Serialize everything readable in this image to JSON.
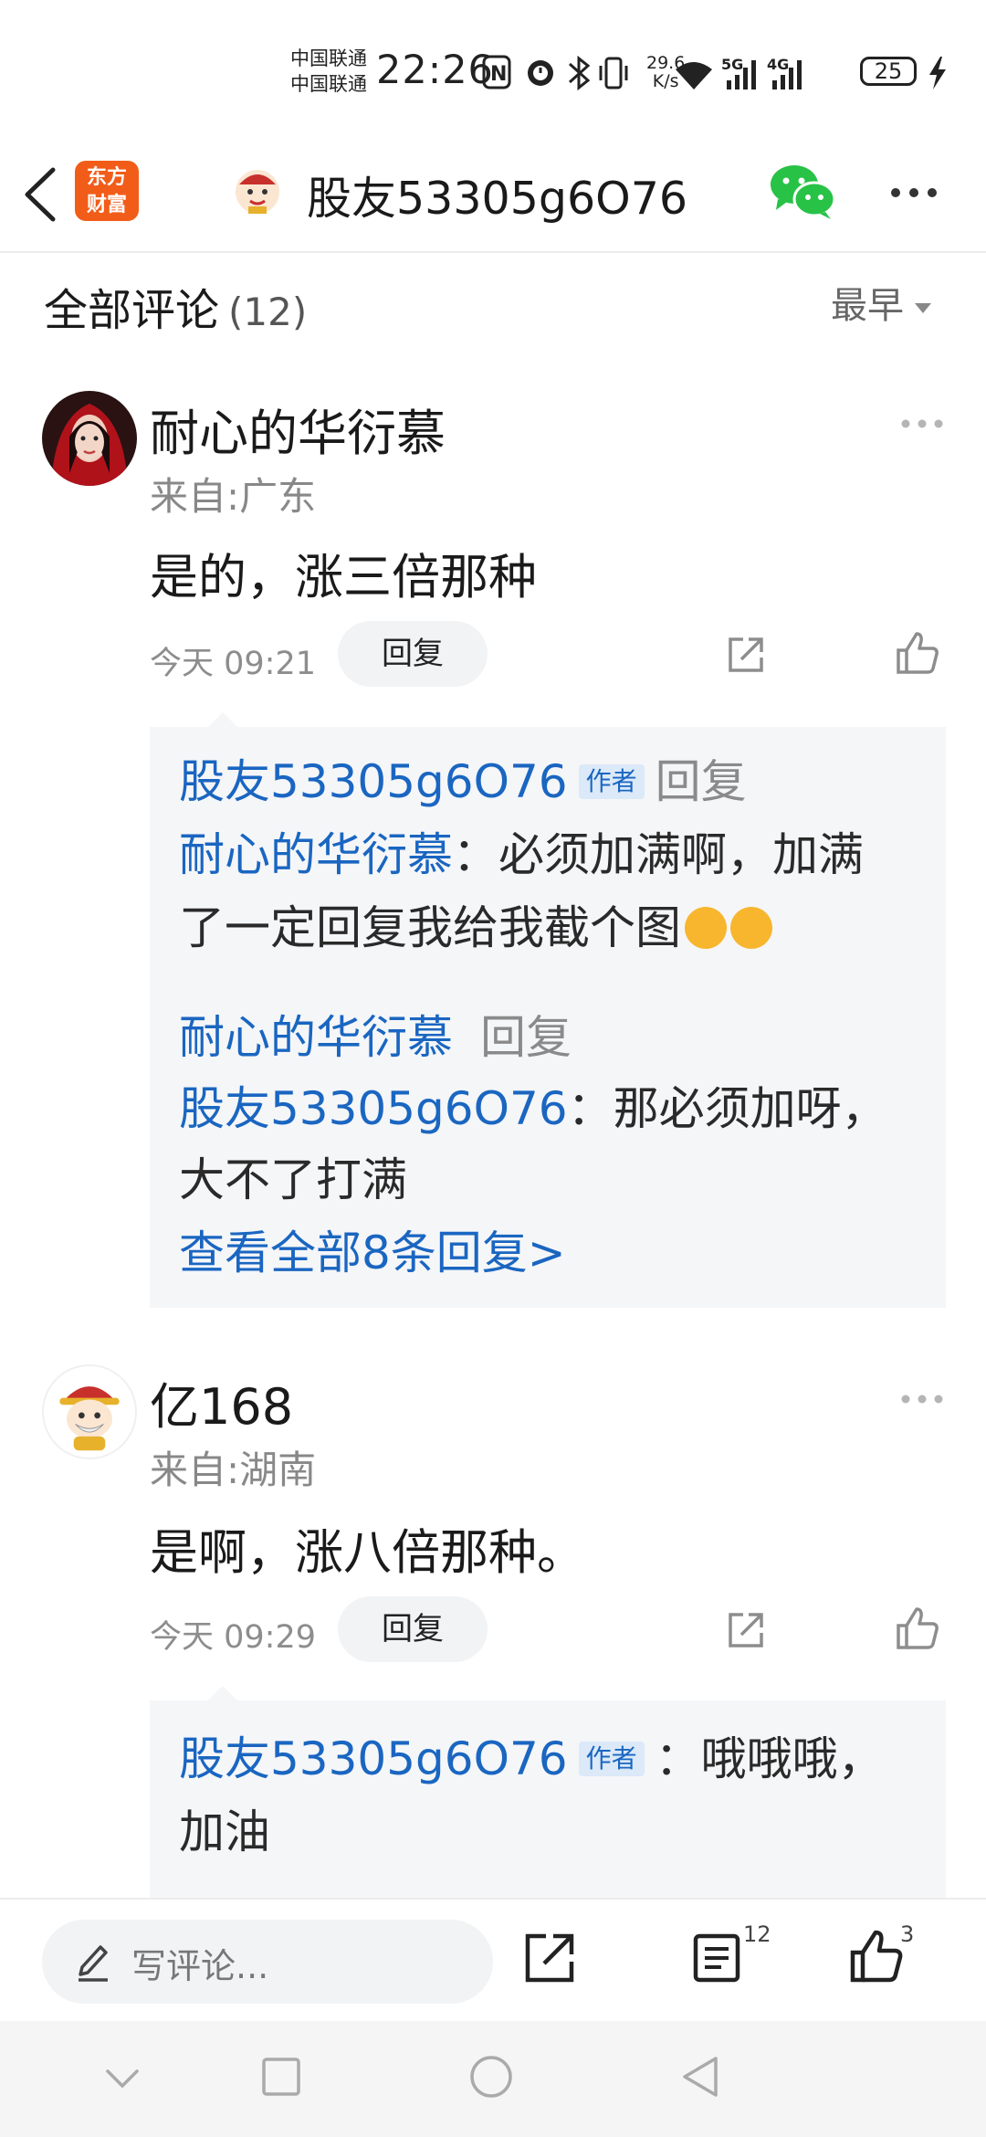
{
  "status_bar": {
    "carrier_1": "中国联通",
    "carrier_2": "中国联通",
    "time": "22:26",
    "net_speed_value": "29.6",
    "net_speed_unit": "K/s",
    "network_1": "5G",
    "network_2": "4G",
    "battery": "25"
  },
  "header": {
    "logo_line1": "东方",
    "logo_line2": "财富",
    "title": "股友53305g6O76",
    "wechat_color": "#27c246",
    "logo_color": "#f25c19"
  },
  "comments_section": {
    "title": "全部评论",
    "count": "(12)",
    "sort": "最早"
  },
  "comments": [
    {
      "user": "耐心的华衍慕",
      "location": "来自:广东",
      "text": "是的，涨三倍那种",
      "time": "今天 09:21",
      "reply_label": "回复",
      "replies": {
        "r1_author": "股友53305g6O76",
        "r1_tag": "作者",
        "r1_action": "回复",
        "r1_target": "耐心的华衍慕",
        "r1_text_a": "：必须加满啊，加满",
        "r1_text_b": "了一定回复我给我截个图",
        "r2_author": "耐心的华衍慕",
        "r2_action": "回复",
        "r2_target": "股友53305g6O76",
        "r2_text_a": "：那必须加呀，",
        "r2_text_b": "大不了打满",
        "view_all": "查看全部8条回复>"
      }
    },
    {
      "user": "亿168",
      "location": "来自:湖南",
      "text": "是啊，涨八倍那种。",
      "time": "今天 09:29",
      "reply_label": "回复",
      "replies": {
        "r1_author": "股友53305g6O76",
        "r1_tag": "作者",
        "r1_text_a": "：哦哦哦，",
        "r1_text_b": "加油"
      }
    }
  ],
  "bottom_bar": {
    "write_placeholder": "写评论...",
    "comment_count": "12",
    "like_count": "3"
  },
  "icons": {
    "back": "chevron-left-icon",
    "wechat": "wechat-icon",
    "more": "more-dots-icon",
    "share": "share-icon",
    "like": "thumbs-up-icon",
    "edit": "pencil-icon",
    "comments": "comment-list-icon"
  }
}
